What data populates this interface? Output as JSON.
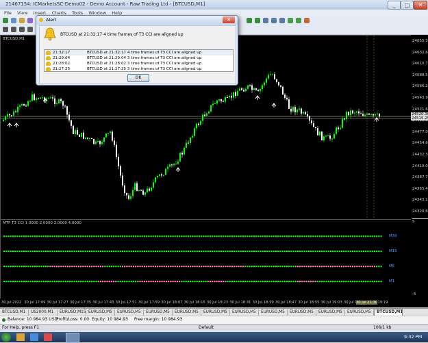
{
  "window": {
    "title": "21467154: ICMarketsSC-Demo02 - Demo Account - Raw Trading Ltd - [BTCUSD,M1]",
    "controls": [
      "_",
      "□",
      "✕"
    ]
  },
  "menu": [
    "File",
    "View",
    "Insert",
    "Charts",
    "Tools",
    "Window",
    "Help"
  ],
  "alert": {
    "title": "Alert",
    "message": "BTCUSD at 21:32:17 4 time frames of T3 CCI are aligned up",
    "rows": [
      {
        "time": "21:32:17",
        "text": "BTCUSD at 21:32:17 4 time frames of T3 CCI are aligned up"
      },
      {
        "time": "21:29:04",
        "text": "BTCUSD at 21:29:04 3 time frames of T3 CCI are aligned up"
      },
      {
        "time": "21:28:02",
        "text": "BTCUSD at 21:28:02 3 time frames of T3 CCI are aligned up"
      },
      {
        "time": "21:27:25",
        "text": "BTCUSD at 21:27:25 3 time frames of T3 CCI are aligned up"
      }
    ],
    "ok_label": "OK"
  },
  "chart": {
    "symbol_label": "BTCUSD,M1",
    "price_ticks": [
      "24655.30",
      "24632.65",
      "24610.75",
      "24588.55",
      "24566.25",
      "24543.90",
      "24521.60",
      "24499.30",
      "24477.00",
      "24454.65",
      "24432.35",
      "24410.05",
      "24387.75",
      "24365.45",
      "24343.15",
      "24320.80"
    ],
    "current_price": "24515.25",
    "bid_tag": "24520.30",
    "colors": {
      "bull": "#00ff00",
      "bear": "#ffffff",
      "background": "#000000",
      "price_line": "#e0e0a0"
    }
  },
  "indicator": {
    "label": "MTF T3 CCI 1.0000 2.0000 3.0000 4.0000",
    "scale_top": "5",
    "scale_bottom": "-5",
    "rows": [
      "M30",
      "M15",
      "M5",
      "M1"
    ]
  },
  "time_axis": [
    "30 Jul 2022",
    "30 Jul 17:09",
    "30 Jul 17:27",
    "30 Jul 17:35",
    "30 Jul 17:43",
    "30 Jul 17:51",
    "30 Jul 17:59",
    "30 Jul 18:07",
    "30 Jul 18:15",
    "30 Jul 18:23",
    "30 Jul 18:31",
    "30 Jul 18:39",
    "30 Jul 18:47",
    "30 Jul 18:55",
    "30 Jul 19:03",
    "30 Jul 19:11",
    "30 Jul 19:19",
    "30 Jul 21:30"
  ],
  "tabs": [
    "BTCUSD,M1",
    "US2000,M1",
    "EURUSD,M15",
    "EURUSD,M5",
    "EURUSD,M5",
    "EURUSD,M5",
    "EURUSD,M5",
    "EURUSD,M5",
    "EURUSD,M5",
    "EURUSD,M5",
    "EURUSD,M5",
    "EURUSD,M5",
    "EURUSD,M5",
    "BTCUSD,M1"
  ],
  "balance_bar": {
    "balance": "Balance: 10 984.93 USD",
    "profit": "Profit/Loss: 0.00",
    "equity": "Equity: 10 984.93",
    "free_margin": "Free margin: 10 984.93"
  },
  "status_bar": {
    "help": "For Help, press F1",
    "profile": "Default",
    "traffic": "106/1 kb"
  },
  "taskbar": {
    "clock": "9:32 PM"
  }
}
